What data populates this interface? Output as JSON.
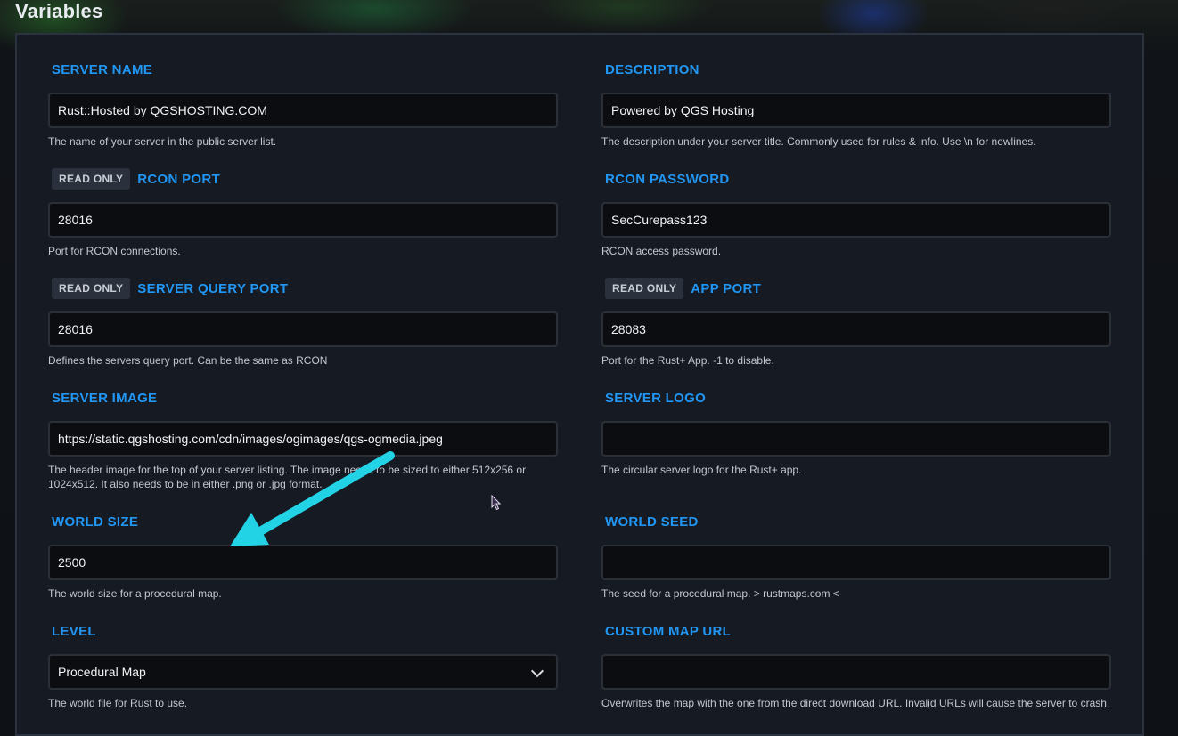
{
  "page_title": "Variables",
  "read_only_label": "READ ONLY",
  "fields": {
    "server_name": {
      "label": "SERVER NAME",
      "value": "Rust::Hosted by QGSHOSTING.COM",
      "help": "The name of your server in the public server list."
    },
    "description": {
      "label": "DESCRIPTION",
      "value": "Powered by QGS Hosting",
      "help": "The description under your server title. Commonly used for rules & info. Use \\n for newlines."
    },
    "rcon_port": {
      "label": "RCON PORT",
      "value": "28016",
      "help": "Port for RCON connections."
    },
    "rcon_password": {
      "label": "RCON PASSWORD",
      "value": "SecCurepass123",
      "help": "RCON access password."
    },
    "server_query_port": {
      "label": "SERVER QUERY PORT",
      "value": "28016",
      "help": "Defines the servers query port. Can be the same as RCON"
    },
    "app_port": {
      "label": "APP PORT",
      "value": "28083",
      "help": "Port for the Rust+ App. -1 to disable."
    },
    "server_image": {
      "label": "SERVER IMAGE",
      "value": "https://static.qgshosting.com/cdn/images/ogimages/qgs-ogmedia.jpeg",
      "help": "The header image for the top of your server listing. The image needs to be sized to either 512x256 or 1024x512. It also needs to be in either .png or .jpg format."
    },
    "server_logo": {
      "label": "SERVER LOGO",
      "value": "",
      "help": "The circular server logo for the Rust+ app."
    },
    "world_size": {
      "label": "WORLD SIZE",
      "value": "2500",
      "help": "The world size for a procedural map."
    },
    "world_seed": {
      "label": "WORLD SEED",
      "value": "",
      "help": "The seed for a procedural map. > rustmaps.com <"
    },
    "level": {
      "label": "LEVEL",
      "value": "Procedural Map",
      "help": "The world file for Rust to use."
    },
    "custom_map_url": {
      "label": "CUSTOM MAP URL",
      "value": "",
      "help": "Overwrites the map with the one from the direct download URL. Invalid URLs will cause the server to crash."
    }
  },
  "colors": {
    "accent": "#2196f3",
    "annotation_arrow": "#22d3e6"
  }
}
